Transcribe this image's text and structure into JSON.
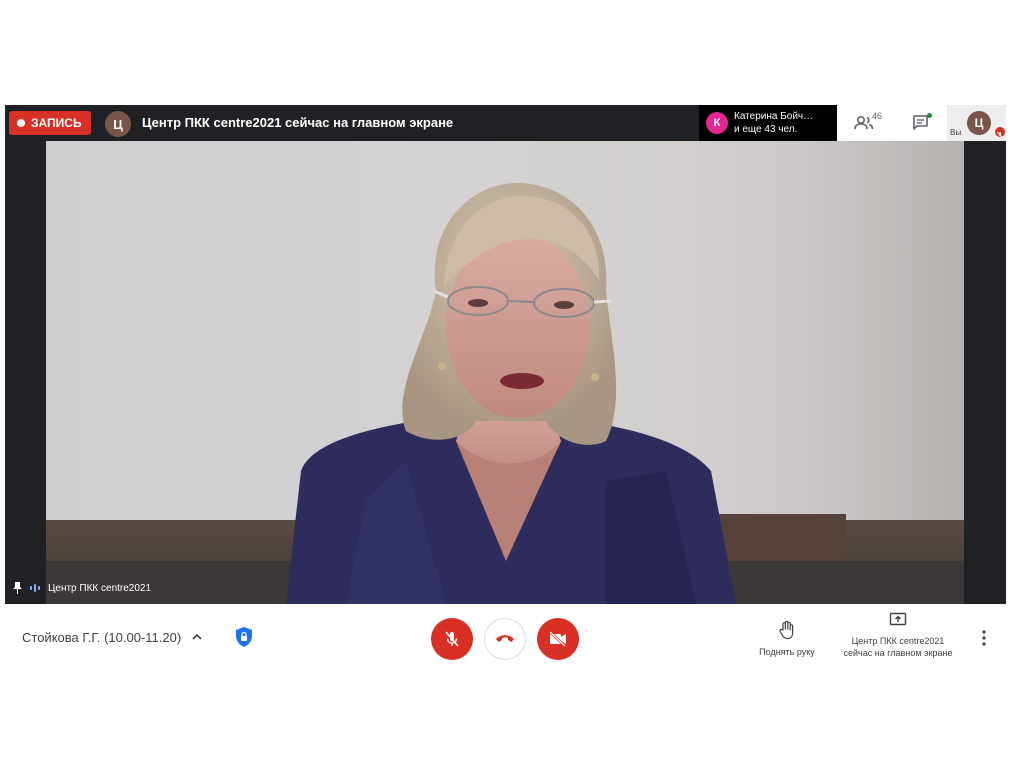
{
  "topbar": {
    "record_label": "ЗАПИСЬ",
    "presenter_initial": "Ц",
    "presenter_text": "Центр ПКК centre2021 сейчас на главном экране",
    "people_initial": "К",
    "people_line1": "Катерина Бойч…",
    "people_line2": "и еще 43 чел.",
    "participant_count": "46",
    "self_initial": "Ц",
    "self_label": "Вы"
  },
  "stage": {
    "caption_name": "Центр ПКК centre2021"
  },
  "bottombar": {
    "meeting_title": "Стойкова Г.Г. (10.00-11.20)",
    "raise_hand_label": "Поднять руку",
    "present_label_line1": "Центр ПКК centre2021",
    "present_label_line2": "сейчас на главном экране"
  },
  "colors": {
    "recording_red": "#d93025",
    "dark_bg": "#202124",
    "avatar_brown": "#795548",
    "avatar_pink": "#e52592",
    "audio_blue": "#8ab4f8",
    "shield_blue": "#1a73e8"
  },
  "icons": {
    "people": "people-icon",
    "chat": "chat-icon",
    "mic_off": "mic-off-icon",
    "hang_up": "hang-up-icon",
    "camera_off": "camera-off-icon",
    "raise_hand": "hand-icon",
    "present": "present-screen-icon",
    "more": "more-vert-icon",
    "shield": "shield-lock-icon",
    "pin": "pin-icon"
  }
}
